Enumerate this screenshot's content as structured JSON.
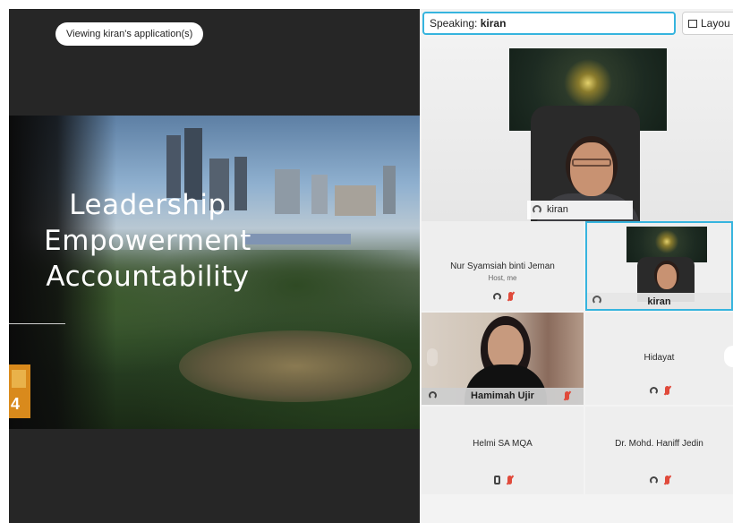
{
  "share": {
    "viewing_label": "Viewing kiran's application(s)",
    "slide": {
      "line1": "Leadership",
      "line2": "Empowerment",
      "line3": "Accountability",
      "logo_text": "4"
    }
  },
  "panel": {
    "speaking_prefix": "Speaking:",
    "speaking_name": "kiran",
    "layout_label": "Layou",
    "main_video_name": "kiran",
    "participants": [
      {
        "name": "Nur Syamsiah binti Jeman",
        "role": "Host, me"
      },
      {
        "name": "kiran"
      },
      {
        "name": "Hamimah Ujir"
      },
      {
        "name": "Hidayat"
      },
      {
        "name": "Helmi SA MQA"
      },
      {
        "name": "Dr. Mohd. Haniff Jedin"
      }
    ]
  },
  "colors": {
    "accent_border": "#36b4de",
    "muted_mic": "#e04a3b",
    "share_background": "#262626"
  },
  "icons": [
    "layout-icon",
    "headset-icon",
    "muted-mic-icon",
    "phone-icon"
  ]
}
